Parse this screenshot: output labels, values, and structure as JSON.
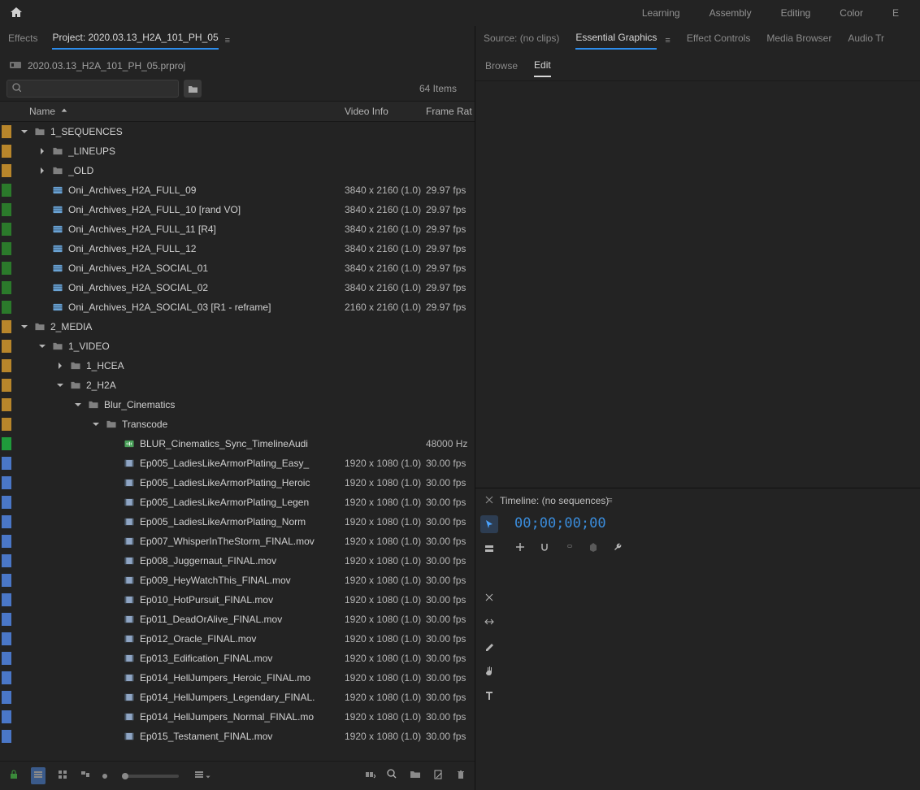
{
  "workspaces": [
    "Learning",
    "Assembly",
    "Editing",
    "Color",
    "E"
  ],
  "leftTabs": {
    "effects": "Effects",
    "project": "Project: 2020.03.13_H2A_101_PH_05"
  },
  "projectFile": "2020.03.13_H2A_101_PH_05.prproj",
  "itemsCount": "64 Items",
  "columns": {
    "name": "Name",
    "video": "Video Info",
    "fps": "Frame Rat"
  },
  "rightTabs": [
    "Source: (no clips)",
    "Essential Graphics",
    "Effect Controls",
    "Media Browser",
    "Audio Tr"
  ],
  "subTabs": [
    "Browse",
    "Edit"
  ],
  "timelineTitle": "Timeline: (no sequences)",
  "timecode": "00;00;00;00",
  "rows": [
    {
      "lbl": "orange",
      "indent": 0,
      "expand": "down",
      "type": "bin",
      "name": "1_SEQUENCES",
      "video": "",
      "fps": ""
    },
    {
      "lbl": "orange",
      "indent": 1,
      "expand": "right",
      "type": "bin",
      "name": "_LINEUPS",
      "video": "",
      "fps": ""
    },
    {
      "lbl": "orange",
      "indent": 1,
      "expand": "right",
      "type": "bin",
      "name": "_OLD",
      "video": "",
      "fps": ""
    },
    {
      "lbl": "green",
      "indent": 1,
      "expand": "none",
      "type": "seq",
      "name": "Oni_Archives_H2A_FULL_09",
      "video": "3840 x 2160 (1.0)",
      "fps": "29.97 fps"
    },
    {
      "lbl": "green",
      "indent": 1,
      "expand": "none",
      "type": "seq",
      "name": "Oni_Archives_H2A_FULL_10 [rand VO]",
      "video": "3840 x 2160 (1.0)",
      "fps": "29.97 fps"
    },
    {
      "lbl": "green",
      "indent": 1,
      "expand": "none",
      "type": "seq",
      "name": "Oni_Archives_H2A_FULL_11 [R4]",
      "video": "3840 x 2160 (1.0)",
      "fps": "29.97 fps"
    },
    {
      "lbl": "green",
      "indent": 1,
      "expand": "none",
      "type": "seq",
      "name": "Oni_Archives_H2A_FULL_12",
      "video": "3840 x 2160 (1.0)",
      "fps": "29.97 fps"
    },
    {
      "lbl": "green",
      "indent": 1,
      "expand": "none",
      "type": "seq",
      "name": "Oni_Archives_H2A_SOCIAL_01",
      "video": "3840 x 2160 (1.0)",
      "fps": "29.97 fps"
    },
    {
      "lbl": "green",
      "indent": 1,
      "expand": "none",
      "type": "seq",
      "name": "Oni_Archives_H2A_SOCIAL_02",
      "video": "3840 x 2160 (1.0)",
      "fps": "29.97 fps"
    },
    {
      "lbl": "green",
      "indent": 1,
      "expand": "none",
      "type": "seq",
      "name": "Oni_Archives_H2A_SOCIAL_03 [R1 - reframe]",
      "video": "2160 x 2160 (1.0)",
      "fps": "29.97 fps"
    },
    {
      "lbl": "orange",
      "indent": 0,
      "expand": "down",
      "type": "bin",
      "name": "2_MEDIA",
      "video": "",
      "fps": ""
    },
    {
      "lbl": "orange",
      "indent": 1,
      "expand": "down",
      "type": "bin",
      "name": "1_VIDEO",
      "video": "",
      "fps": ""
    },
    {
      "lbl": "orange",
      "indent": 2,
      "expand": "right",
      "type": "bin",
      "name": "1_HCEA",
      "video": "",
      "fps": ""
    },
    {
      "lbl": "orange",
      "indent": 2,
      "expand": "down",
      "type": "bin",
      "name": "2_H2A",
      "video": "",
      "fps": ""
    },
    {
      "lbl": "orange",
      "indent": 3,
      "expand": "down",
      "type": "bin",
      "name": "Blur_Cinematics",
      "video": "",
      "fps": ""
    },
    {
      "lbl": "orange",
      "indent": 4,
      "expand": "down",
      "type": "bin",
      "name": "Transcode",
      "video": "",
      "fps": ""
    },
    {
      "lbl": "green2",
      "indent": 5,
      "expand": "none",
      "type": "audio",
      "name": "BLUR_Cinematics_Sync_TimelineAudi",
      "video": "",
      "fps": "48000 Hz"
    },
    {
      "lbl": "blue",
      "indent": 5,
      "expand": "none",
      "type": "clip",
      "name": "Ep005_LadiesLikeArmorPlating_Easy_",
      "video": "1920 x 1080 (1.0)",
      "fps": "30.00 fps"
    },
    {
      "lbl": "blue",
      "indent": 5,
      "expand": "none",
      "type": "clip",
      "name": "Ep005_LadiesLikeArmorPlating_Heroic",
      "video": "1920 x 1080 (1.0)",
      "fps": "30.00 fps"
    },
    {
      "lbl": "blue",
      "indent": 5,
      "expand": "none",
      "type": "clip",
      "name": "Ep005_LadiesLikeArmorPlating_Legen",
      "video": "1920 x 1080 (1.0)",
      "fps": "30.00 fps"
    },
    {
      "lbl": "blue",
      "indent": 5,
      "expand": "none",
      "type": "clip",
      "name": "Ep005_LadiesLikeArmorPlating_Norm",
      "video": "1920 x 1080 (1.0)",
      "fps": "30.00 fps"
    },
    {
      "lbl": "blue",
      "indent": 5,
      "expand": "none",
      "type": "clip",
      "name": "Ep007_WhisperInTheStorm_FINAL.mov",
      "video": "1920 x 1080 (1.0)",
      "fps": "30.00 fps"
    },
    {
      "lbl": "blue",
      "indent": 5,
      "expand": "none",
      "type": "clip",
      "name": "Ep008_Juggernaut_FINAL.mov",
      "video": "1920 x 1080 (1.0)",
      "fps": "30.00 fps"
    },
    {
      "lbl": "blue",
      "indent": 5,
      "expand": "none",
      "type": "clip",
      "name": "Ep009_HeyWatchThis_FINAL.mov",
      "video": "1920 x 1080 (1.0)",
      "fps": "30.00 fps"
    },
    {
      "lbl": "blue",
      "indent": 5,
      "expand": "none",
      "type": "clip",
      "name": "Ep010_HotPursuit_FINAL.mov",
      "video": "1920 x 1080 (1.0)",
      "fps": "30.00 fps"
    },
    {
      "lbl": "blue",
      "indent": 5,
      "expand": "none",
      "type": "clip",
      "name": "Ep011_DeadOrAlive_FINAL.mov",
      "video": "1920 x 1080 (1.0)",
      "fps": "30.00 fps"
    },
    {
      "lbl": "blue",
      "indent": 5,
      "expand": "none",
      "type": "clip",
      "name": "Ep012_Oracle_FINAL.mov",
      "video": "1920 x 1080 (1.0)",
      "fps": "30.00 fps"
    },
    {
      "lbl": "blue",
      "indent": 5,
      "expand": "none",
      "type": "clip",
      "name": "Ep013_Edification_FINAL.mov",
      "video": "1920 x 1080 (1.0)",
      "fps": "30.00 fps"
    },
    {
      "lbl": "blue",
      "indent": 5,
      "expand": "none",
      "type": "clip",
      "name": "Ep014_HellJumpers_Heroic_FINAL.mo",
      "video": "1920 x 1080 (1.0)",
      "fps": "30.00 fps"
    },
    {
      "lbl": "blue",
      "indent": 5,
      "expand": "none",
      "type": "clip",
      "name": "Ep014_HellJumpers_Legendary_FINAL.",
      "video": "1920 x 1080 (1.0)",
      "fps": "30.00 fps"
    },
    {
      "lbl": "blue",
      "indent": 5,
      "expand": "none",
      "type": "clip",
      "name": "Ep014_HellJumpers_Normal_FINAL.mo",
      "video": "1920 x 1080 (1.0)",
      "fps": "30.00 fps"
    },
    {
      "lbl": "blue",
      "indent": 5,
      "expand": "none",
      "type": "clip",
      "name": "Ep015_Testament_FINAL.mov",
      "video": "1920 x 1080 (1.0)",
      "fps": "30.00 fps"
    }
  ]
}
